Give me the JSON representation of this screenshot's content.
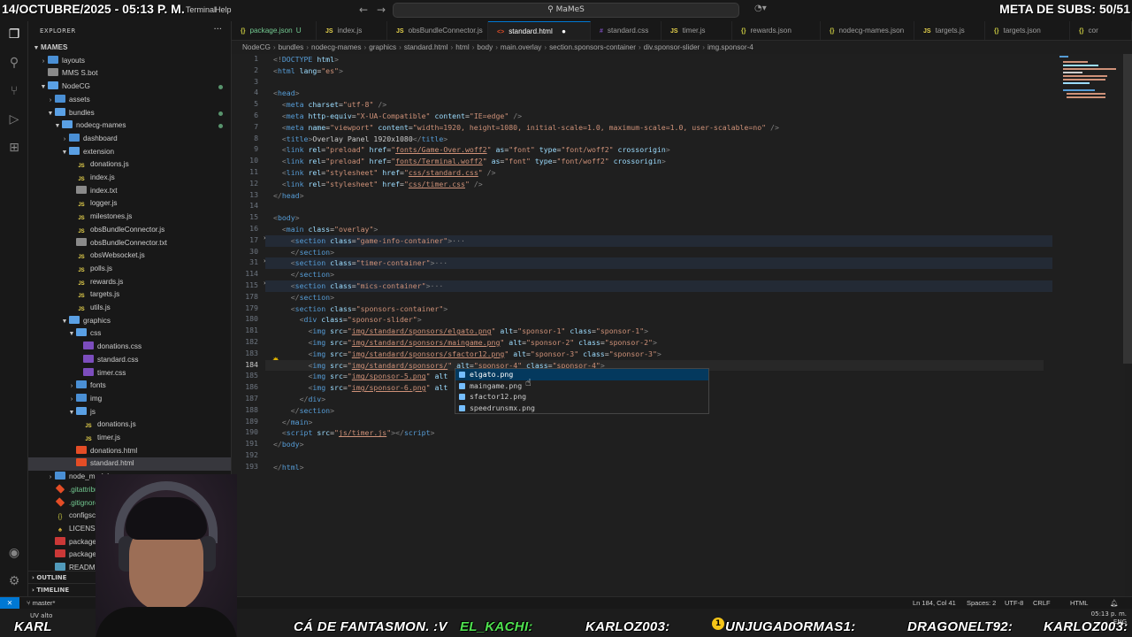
{
  "overlay": {
    "date_time": "14/OCTUBRE/2025 - 05:13 P. M.",
    "subs_goal": "META DE SUBS: 50/51"
  },
  "titlebar": {
    "menu_terminal": "Terminal",
    "menu_help": "Help",
    "search_text": "MaMeS"
  },
  "sidebar": {
    "title": "EXPLORER",
    "root": "MAMES",
    "items": [
      {
        "label": "layouts",
        "type": "folder",
        "depth": 1,
        "open": false
      },
      {
        "label": "MMS S.bot",
        "type": "txt",
        "depth": 1
      },
      {
        "label": "NodeCG",
        "type": "folder",
        "depth": 1,
        "open": true
      },
      {
        "label": "assets",
        "type": "folder",
        "depth": 2,
        "open": false
      },
      {
        "label": "bundles",
        "type": "folder",
        "depth": 2,
        "open": true
      },
      {
        "label": "nodecg-mames",
        "type": "folder",
        "depth": 3,
        "open": true
      },
      {
        "label": "dashboard",
        "type": "folder",
        "depth": 4,
        "open": false
      },
      {
        "label": "extension",
        "type": "folder",
        "depth": 4,
        "open": true
      },
      {
        "label": "donations.js",
        "type": "js",
        "depth": 5
      },
      {
        "label": "index.js",
        "type": "js",
        "depth": 5
      },
      {
        "label": "index.txt",
        "type": "txt",
        "depth": 5
      },
      {
        "label": "logger.js",
        "type": "js",
        "depth": 5
      },
      {
        "label": "milestones.js",
        "type": "js",
        "depth": 5
      },
      {
        "label": "obsBundleConnector.js",
        "type": "js",
        "depth": 5
      },
      {
        "label": "obsBundleConnector.txt",
        "type": "txt",
        "depth": 5
      },
      {
        "label": "obsWebsocket.js",
        "type": "js",
        "depth": 5
      },
      {
        "label": "polls.js",
        "type": "js",
        "depth": 5
      },
      {
        "label": "rewards.js",
        "type": "js",
        "depth": 5
      },
      {
        "label": "targets.js",
        "type": "js",
        "depth": 5
      },
      {
        "label": "utils.js",
        "type": "js",
        "depth": 5
      },
      {
        "label": "graphics",
        "type": "folder",
        "depth": 4,
        "open": true
      },
      {
        "label": "css",
        "type": "folder",
        "depth": 5,
        "open": true
      },
      {
        "label": "donations.css",
        "type": "css",
        "depth": 6
      },
      {
        "label": "standard.css",
        "type": "css",
        "depth": 6
      },
      {
        "label": "timer.css",
        "type": "css",
        "depth": 6
      },
      {
        "label": "fonts",
        "type": "folder",
        "depth": 5,
        "open": false
      },
      {
        "label": "img",
        "type": "folder",
        "depth": 5,
        "open": false
      },
      {
        "label": "js",
        "type": "folder",
        "depth": 5,
        "open": true
      },
      {
        "label": "donations.js",
        "type": "js",
        "depth": 6
      },
      {
        "label": "timer.js",
        "type": "js",
        "depth": 6
      },
      {
        "label": "donations.html",
        "type": "html",
        "depth": 5
      },
      {
        "label": "standard.html",
        "type": "html",
        "depth": 5,
        "selected": true
      },
      {
        "label": "node_modules",
        "type": "folder",
        "depth": 2,
        "open": false
      },
      {
        "label": ".gitattributes",
        "type": "git",
        "depth": 2
      },
      {
        "label": ".gitignore",
        "type": "git",
        "depth": 2
      },
      {
        "label": "configsch",
        "type": "json",
        "depth": 2
      },
      {
        "label": "LICENSE",
        "type": "lic",
        "depth": 2
      },
      {
        "label": "package",
        "type": "pkg",
        "depth": 2
      },
      {
        "label": "package",
        "type": "pkg",
        "depth": 2
      },
      {
        "label": "READM",
        "type": "md",
        "depth": 2
      }
    ],
    "outline": "OUTLINE",
    "timeline": "TIMELINE",
    "badge_u": "U"
  },
  "tabs": [
    {
      "label": "package.json",
      "icon": "{}",
      "kind": "json",
      "badge": "U"
    },
    {
      "label": "index.js",
      "icon": "JS",
      "kind": "js"
    },
    {
      "label": "obsBundleConnector.js",
      "icon": "JS",
      "kind": "js"
    },
    {
      "label": "standard.html",
      "icon": "<>",
      "kind": "html",
      "active": true
    },
    {
      "label": "standard.css",
      "icon": "#",
      "kind": "css"
    },
    {
      "label": "timer.js",
      "icon": "JS",
      "kind": "js"
    },
    {
      "label": "rewards.json",
      "icon": "{}",
      "kind": "json"
    },
    {
      "label": "nodecg-mames.json",
      "icon": "{}",
      "kind": "json"
    },
    {
      "label": "targets.js",
      "icon": "JS",
      "kind": "js"
    },
    {
      "label": "targets.json",
      "icon": "{}",
      "kind": "json"
    },
    {
      "label": "cor",
      "icon": "{}",
      "kind": "json"
    }
  ],
  "breadcrumb": [
    "NodeCG",
    "bundles",
    "nodecg-mames",
    "graphics",
    "standard.html",
    "html",
    "body",
    "main.overlay",
    "section.sponsors-container",
    "div.sponsor-slider",
    "img.sponsor-4"
  ],
  "editor": {
    "line_numbers": [
      "1",
      "2",
      "3",
      "4",
      "5",
      "6",
      "7",
      "8",
      "9",
      "10",
      "11",
      "12",
      "13",
      "14",
      "15",
      "16",
      "17",
      "30",
      "31",
      "114",
      "115",
      "178",
      "179",
      "180",
      "181",
      "182",
      "183",
      "184",
      "185",
      "186",
      "187",
      "188",
      "189",
      "190",
      "191",
      "192",
      "193"
    ],
    "current_line": "184"
  },
  "suggest": [
    "elgato.png",
    "maingame.png",
    "sfactor12.png",
    "speedrunsmx.png"
  ],
  "status": {
    "branch": "master*",
    "position": "Ln 184, Col 41",
    "spaces": "Spaces: 2",
    "encoding": "UTF-8",
    "eol": "CRLF",
    "language": "HTML"
  },
  "ticker": {
    "t1": "KARL",
    "t2": "CÁ DE FANTASMON. :V",
    "t3": "EL_KACHI:",
    "t4": "KARLOZ003:",
    "t5": "UNJUGADORMAS1:",
    "t6": "DRAGONELT92:",
    "t7": "KARLOZ003:",
    "uv": "UV alto"
  },
  "tray": {
    "lang": "ENG",
    "time": "05:13 p. m."
  },
  "colors": {
    "accent": "#0078d4",
    "tag": "#569cd6",
    "attr": "#9cdcfe",
    "string": "#ce9178"
  }
}
